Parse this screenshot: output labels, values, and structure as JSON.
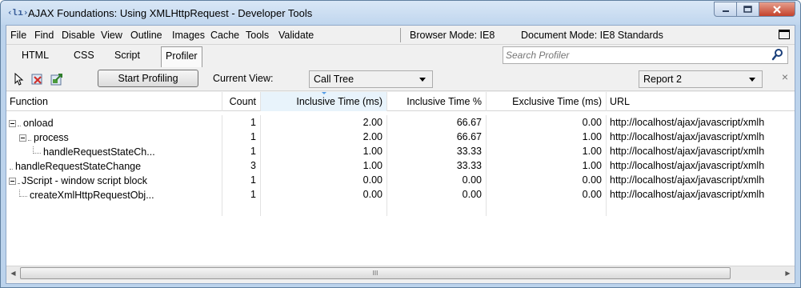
{
  "window": {
    "app_icon_text": "‹lı›",
    "title": "AJAX Foundations: Using XMLHttpRequest - Developer Tools"
  },
  "menubar": {
    "items": [
      "File",
      "Find",
      "Disable",
      "View",
      "Outline",
      "Images",
      "Cache",
      "Tools",
      "Validate"
    ],
    "browser_mode": "Browser Mode: IE8",
    "document_mode": "Document Mode: IE8 Standards"
  },
  "tabs": {
    "items": [
      "HTML",
      "CSS",
      "Script",
      "Profiler"
    ],
    "active": "Profiler",
    "search_placeholder": "Search Profiler"
  },
  "toolbar": {
    "start_label": "Start Profiling",
    "view_label": "Current View:",
    "view_value": "Call Tree",
    "report_value": "Report 2",
    "close_glyph": "×"
  },
  "grid": {
    "columns": [
      "Function",
      "Count",
      "Inclusive Time (ms)",
      "Inclusive Time %",
      "Exclusive Time (ms)",
      "URL"
    ],
    "sorted_column": "Inclusive Time (ms)",
    "rows": [
      {
        "function": "onload",
        "count": "1",
        "incl_ms": "2.00",
        "incl_pct": "66.67",
        "excl_ms": "0.00",
        "url": "http://localhost/ajax/javascript/xmlh"
      },
      {
        "function": "process",
        "count": "1",
        "incl_ms": "2.00",
        "incl_pct": "66.67",
        "excl_ms": "1.00",
        "url": "http://localhost/ajax/javascript/xmlh"
      },
      {
        "function": "handleRequestStateCh...",
        "count": "1",
        "incl_ms": "1.00",
        "incl_pct": "33.33",
        "excl_ms": "1.00",
        "url": "http://localhost/ajax/javascript/xmlh"
      },
      {
        "function": "handleRequestStateChange",
        "count": "3",
        "incl_ms": "1.00",
        "incl_pct": "33.33",
        "excl_ms": "1.00",
        "url": "http://localhost/ajax/javascript/xmlh"
      },
      {
        "function": "JScript - window script block",
        "count": "1",
        "incl_ms": "0.00",
        "incl_pct": "0.00",
        "excl_ms": "0.00",
        "url": "http://localhost/ajax/javascript/xmlh"
      },
      {
        "function": "createXmlHttpRequestObj...",
        "count": "1",
        "incl_ms": "0.00",
        "incl_pct": "0.00",
        "excl_ms": "0.00",
        "url": "http://localhost/ajax/javascript/xmlh"
      }
    ]
  },
  "scrollbar": {
    "grip": "III"
  },
  "colors": {
    "titlebar": "#c0d6ee",
    "close_button": "#c4422b",
    "sorted_header": "#e8f3fb",
    "sort_caret": "#569de5"
  }
}
